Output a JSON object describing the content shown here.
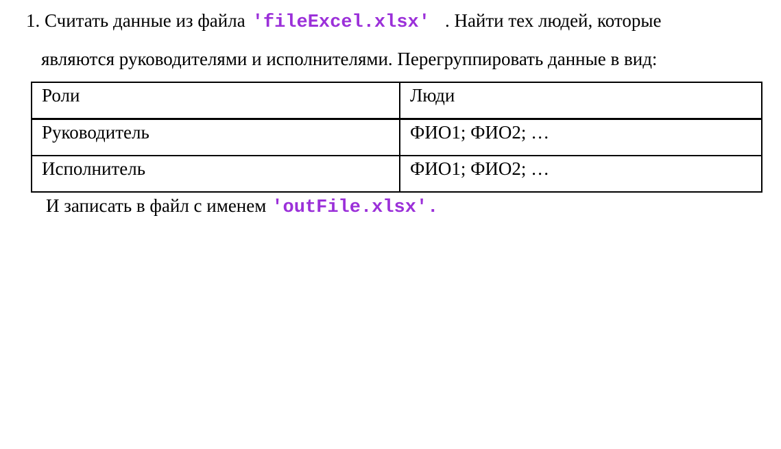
{
  "task": {
    "number": "1.",
    "text_before_file": "Считать данные из файла",
    "input_file": "'fileExcel.xlsx'",
    "text_after_file": ". Найти тех людей, которые",
    "line2": "являются руководителями и исполнителями. Перегруппировать данные в вид:",
    "write_text": "И записать в файл с именем",
    "output_file": "'outFile.xlsx'."
  },
  "table": {
    "headers": [
      "Роли",
      "Люди"
    ],
    "rows": [
      [
        "Руководитель",
        "ФИО1; ФИО2; …"
      ],
      [
        "Исполнитель",
        "ФИО1; ФИО2; …"
      ]
    ]
  },
  "colors": {
    "code": "#9b30d9",
    "text": "#000000"
  }
}
